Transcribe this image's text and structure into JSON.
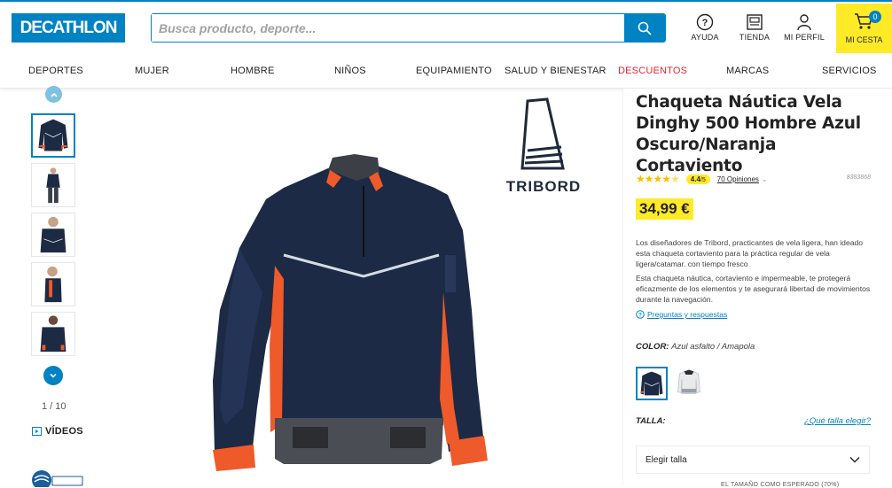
{
  "header": {
    "logo": "DECATHLON",
    "search_placeholder": "Busca producto, deporte...",
    "tools": {
      "help": "AYUDA",
      "store": "TIENDA",
      "profile": "MI PERFIL"
    },
    "cart": {
      "label": "MI CESTA",
      "count": "0"
    }
  },
  "nav": {
    "items": [
      "DEPORTES",
      "MUJER",
      "HOMBRE",
      "NIÑOS",
      "EQUIPAMIENTO",
      "SALUD Y BIENESTAR",
      "DESCUENTOS",
      "MARCAS",
      "SERVICIOS"
    ]
  },
  "gallery": {
    "counter": "1 / 10",
    "videos_label": "VÍDEOS",
    "brand_word": "TRIBORD"
  },
  "product": {
    "title": "Chaqueta Náutica Vela Dinghy 500 Hombre Azul Oscuro/Naranja Cortaviento",
    "rating": "4.4",
    "rating_max": "/5",
    "opinions": "70 Opiniones",
    "sku": "8383868",
    "price": "34,99 €",
    "description": [
      "Los diseñadores de Tribord, practicantes de vela ligera, han ideado esta chaqueta cortaviento para la práctica regular de vela ligera/catamar. con tiempo fresco",
      "Esta chaqueta náutica, cortaviento e impermeable, te protegerá eficazmente de los elementos y te asegurará libertad de movimientos durante la navegación."
    ],
    "qa_link": "Preguntas y respuestas",
    "color_label": "COLOR:",
    "color_value": "Azul asfalto / Amapola",
    "size_label": "TALLA:",
    "size_guide": "¿Qué talla elegir?",
    "size_select": "Elegir talla",
    "bottom_text": "EL TAMAÑO COMO ESPERADO (70%)"
  },
  "colors": {
    "brand_blue": "#0082c3",
    "yellow": "#ffea28",
    "discount_red": "#e3262f"
  }
}
